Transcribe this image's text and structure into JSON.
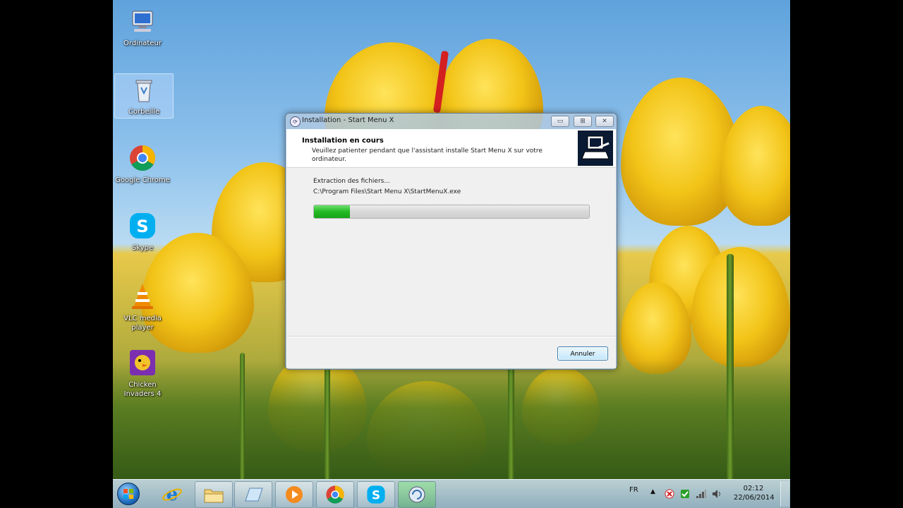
{
  "desktop": {
    "icons": [
      {
        "label": "Ordinateur",
        "icon": "computer-icon"
      },
      {
        "label": "Corbeille",
        "icon": "recycle-bin-icon"
      },
      {
        "label": "Google Chrome",
        "icon": "chrome-icon"
      },
      {
        "label": "Skype",
        "icon": "skype-icon"
      },
      {
        "label": "VLC media player",
        "icon": "vlc-icon"
      },
      {
        "label": "Chicken Invaders 4",
        "icon": "chicken-invaders-icon"
      }
    ]
  },
  "dialog": {
    "title": "Installation - Start Menu X",
    "header_title": "Installation en cours",
    "header_subtitle": "Veuillez patienter pendant que l'assistant installe Start Menu X sur votre ordinateur.",
    "status": "Extraction des fichiers...",
    "file_path": "C:\\Program Files\\Start Menu X\\StartMenuX.exe",
    "progress_fraction": 0.13,
    "cancel_label": "Annuler",
    "title_buttons": {
      "minimize": "▭",
      "maximize": "⊞",
      "close": "✕"
    }
  },
  "taskbar": {
    "items": [
      "start-orb-icon",
      "internet-explorer-icon",
      "explorer-folder-icon",
      "window-icon",
      "media-player-icon",
      "chrome-icon",
      "skype-icon",
      "installer-icon"
    ],
    "tray": {
      "language": "FR",
      "time": "02:12",
      "date": "22/06/2014"
    }
  },
  "colors": {
    "progress_green": "#23b923",
    "accent_blue": "#3c7fb1"
  }
}
